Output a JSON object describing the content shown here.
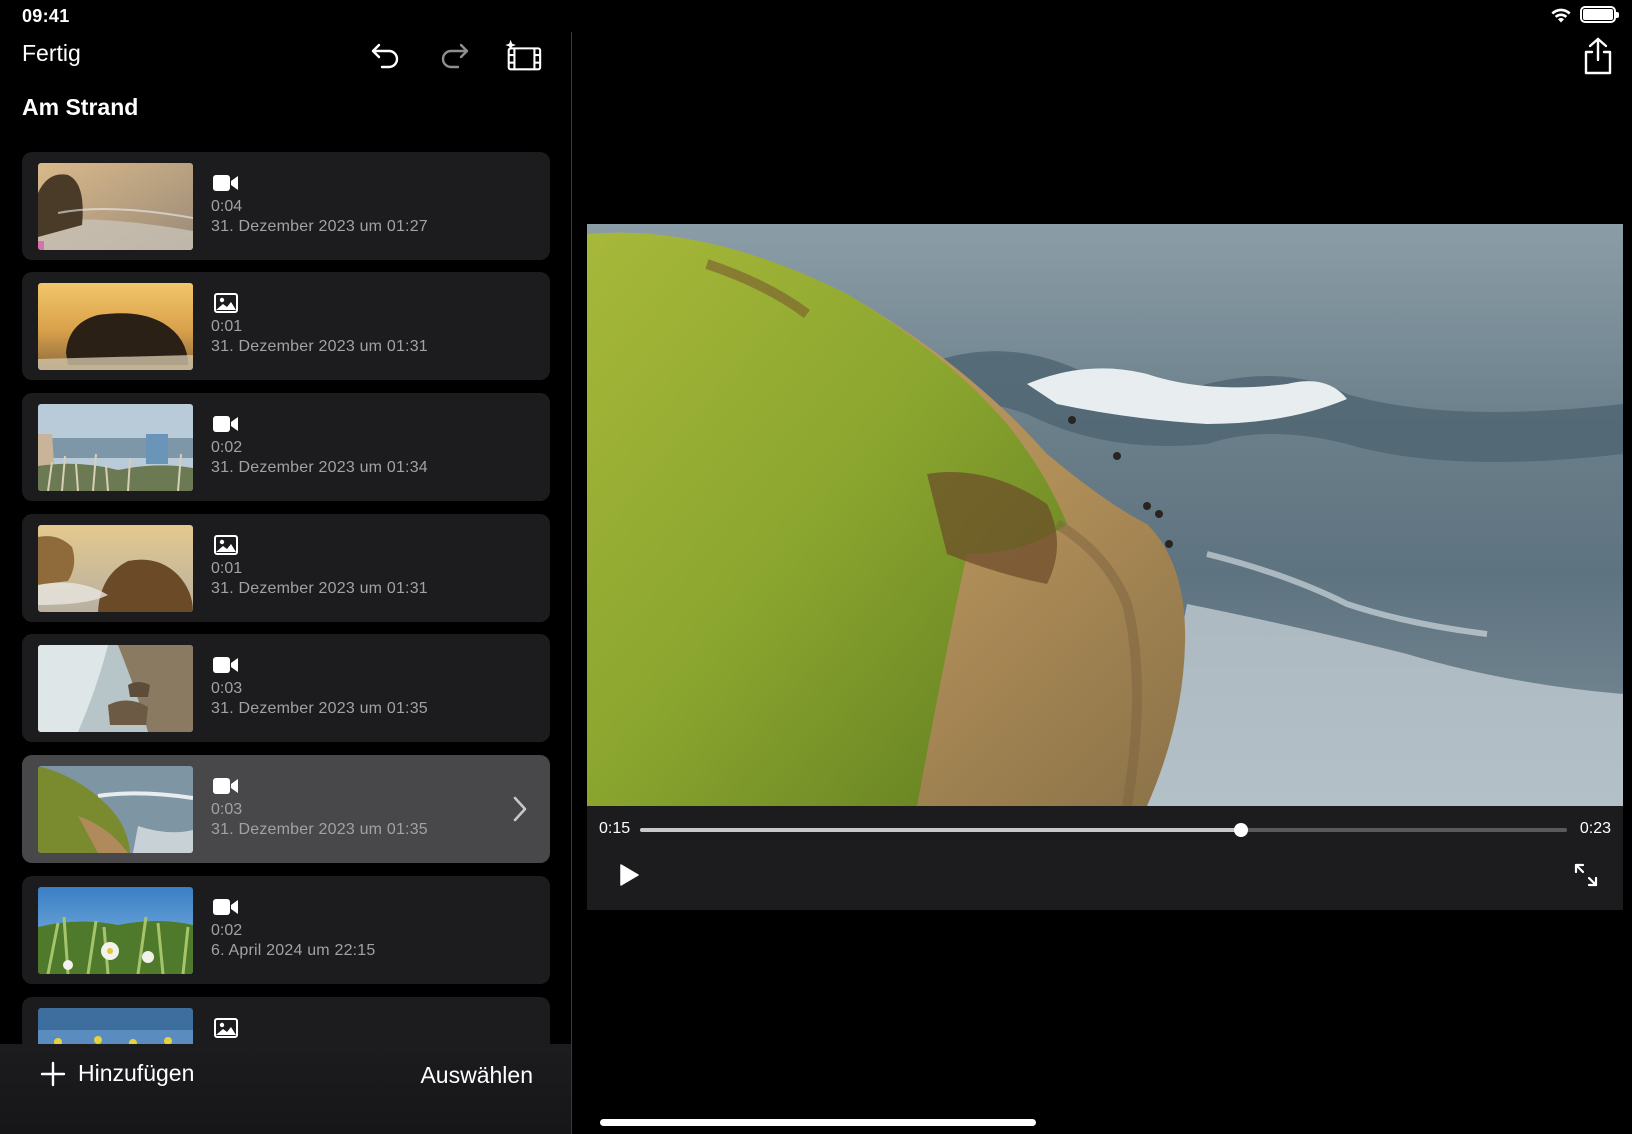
{
  "status_bar": {
    "time": "09:41"
  },
  "toolbar": {
    "done_label": "Fertig"
  },
  "project": {
    "title": "Am Strand"
  },
  "clips": [
    {
      "type": "video-camera-icon",
      "duration": "0:04",
      "date": "31. Dezember 2023 um 01:27",
      "selected": false
    },
    {
      "type": "photo-icon",
      "duration": "0:01",
      "date": "31. Dezember 2023 um 01:31",
      "selected": false
    },
    {
      "type": "video-camera-icon",
      "duration": "0:02",
      "date": "31. Dezember 2023 um 01:34",
      "selected": false
    },
    {
      "type": "photo-icon",
      "duration": "0:01",
      "date": "31. Dezember 2023 um 01:31",
      "selected": false
    },
    {
      "type": "video-camera-icon",
      "duration": "0:03",
      "date": "31. Dezember 2023 um 01:35",
      "selected": false
    },
    {
      "type": "video-camera-icon",
      "duration": "0:03",
      "date": "31. Dezember 2023 um 01:35",
      "selected": true
    },
    {
      "type": "video-camera-icon",
      "duration": "0:02",
      "date": "6. April 2024 um 22:15",
      "selected": false
    },
    {
      "type": "photo-icon",
      "duration": "",
      "date": "",
      "selected": false
    }
  ],
  "footer": {
    "add_label": "Hinzufügen",
    "select_label": "Auswählen"
  },
  "player": {
    "current_time": "0:15",
    "total_time": "0:23",
    "progress": 0.648
  },
  "colors": {
    "background": "#000000",
    "cell": "#1c1c1e",
    "cell_selected": "#48484a",
    "secondary_text": "#a1a1a6"
  }
}
